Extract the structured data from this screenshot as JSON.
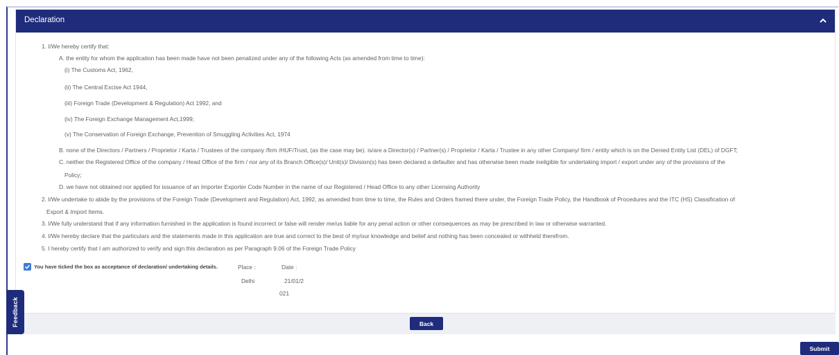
{
  "header": {
    "title": "Declaration"
  },
  "declaration": {
    "p1": "1. I/We hereby certify that:",
    "p1A": "A. the entity for whom the application has been made have not been penalized under any of the following Acts (as amended from time to time):",
    "acts": [
      "(i) The Customs Act, 1962,",
      "(ii) The Central Excise Act 1944,",
      "(iii) Foreign Trade (Development & Regulation) Act 1992, and",
      "(iv) The Foreign Exchange Management Act,1999;",
      "(v) The Conservation of Foreign Exchange, Prevention of Smuggling Activities Act, 1974"
    ],
    "p1B": "B. none of the Directors / Partners / Proprietor / Karta / Trustees of the company /firm /HUF/Trust, (as the case may be). is/are a Director(s) / Partner(s) / Proprietor / Karta / Trustee in any other Company/ firm / entity which is on the Denied Entity List (DEL) of DGFT;",
    "p1C_line1": "C. neither the Registered Office of the company / Head Office of the firm / nor any of its Branch Office(s)/ Unit(s)/ Division(s) has been declared a defaulter and has otherwise been made ineligible for undertaking import / export under any of the provisions of the",
    "p1C_line2": "Policy;",
    "p1D": "D. we have not obtained nor applied for issuance of an Importer Exporter Code Number in the name of our Registered / Head Office to any other Licensing Authority",
    "p2_line1": "2. I/We undertake to abide by the provisions of the Foreign Trade (Development and Regulation) Act, 1992, as amended from time to time, the Rules and Orders framed there under, the Foreign Trade Policy, the Handbook of Procedures and the ITC (HS) Classification of",
    "p2_line2": "Export & Import Items.",
    "p3": "3. I/We fully understand that if any information furnished in the application is found incorrect or false will render me/us liable for any penal action or other consequences as may be prescribed in law or otherwise warranted.",
    "p4": "4. I/We hereby declare that the particulars and the statements made in this application are true and correct to the best of my/our knowledge and belief and nothing has been concealed or withheld therefrom.",
    "p5": "5. I hereby certify that I am authorized to verify and sign this declaration as per Paragraph 9.06 of the Foreign Trade Policy"
  },
  "acceptance": {
    "checked": true,
    "label": "You have ticked the box as acceptance of declaration/ undertaking details.",
    "place_label": "Place :",
    "place_value": "Delhi",
    "date_label": "Date :",
    "date_value_line1": "21/01/2",
    "date_value_line2": "021"
  },
  "buttons": {
    "back": "Back",
    "submit": "Submit"
  },
  "feedback": {
    "label": "Feedback"
  },
  "colors": {
    "primary": "#1f2b7b",
    "checkbox": "#3b7cd8"
  }
}
